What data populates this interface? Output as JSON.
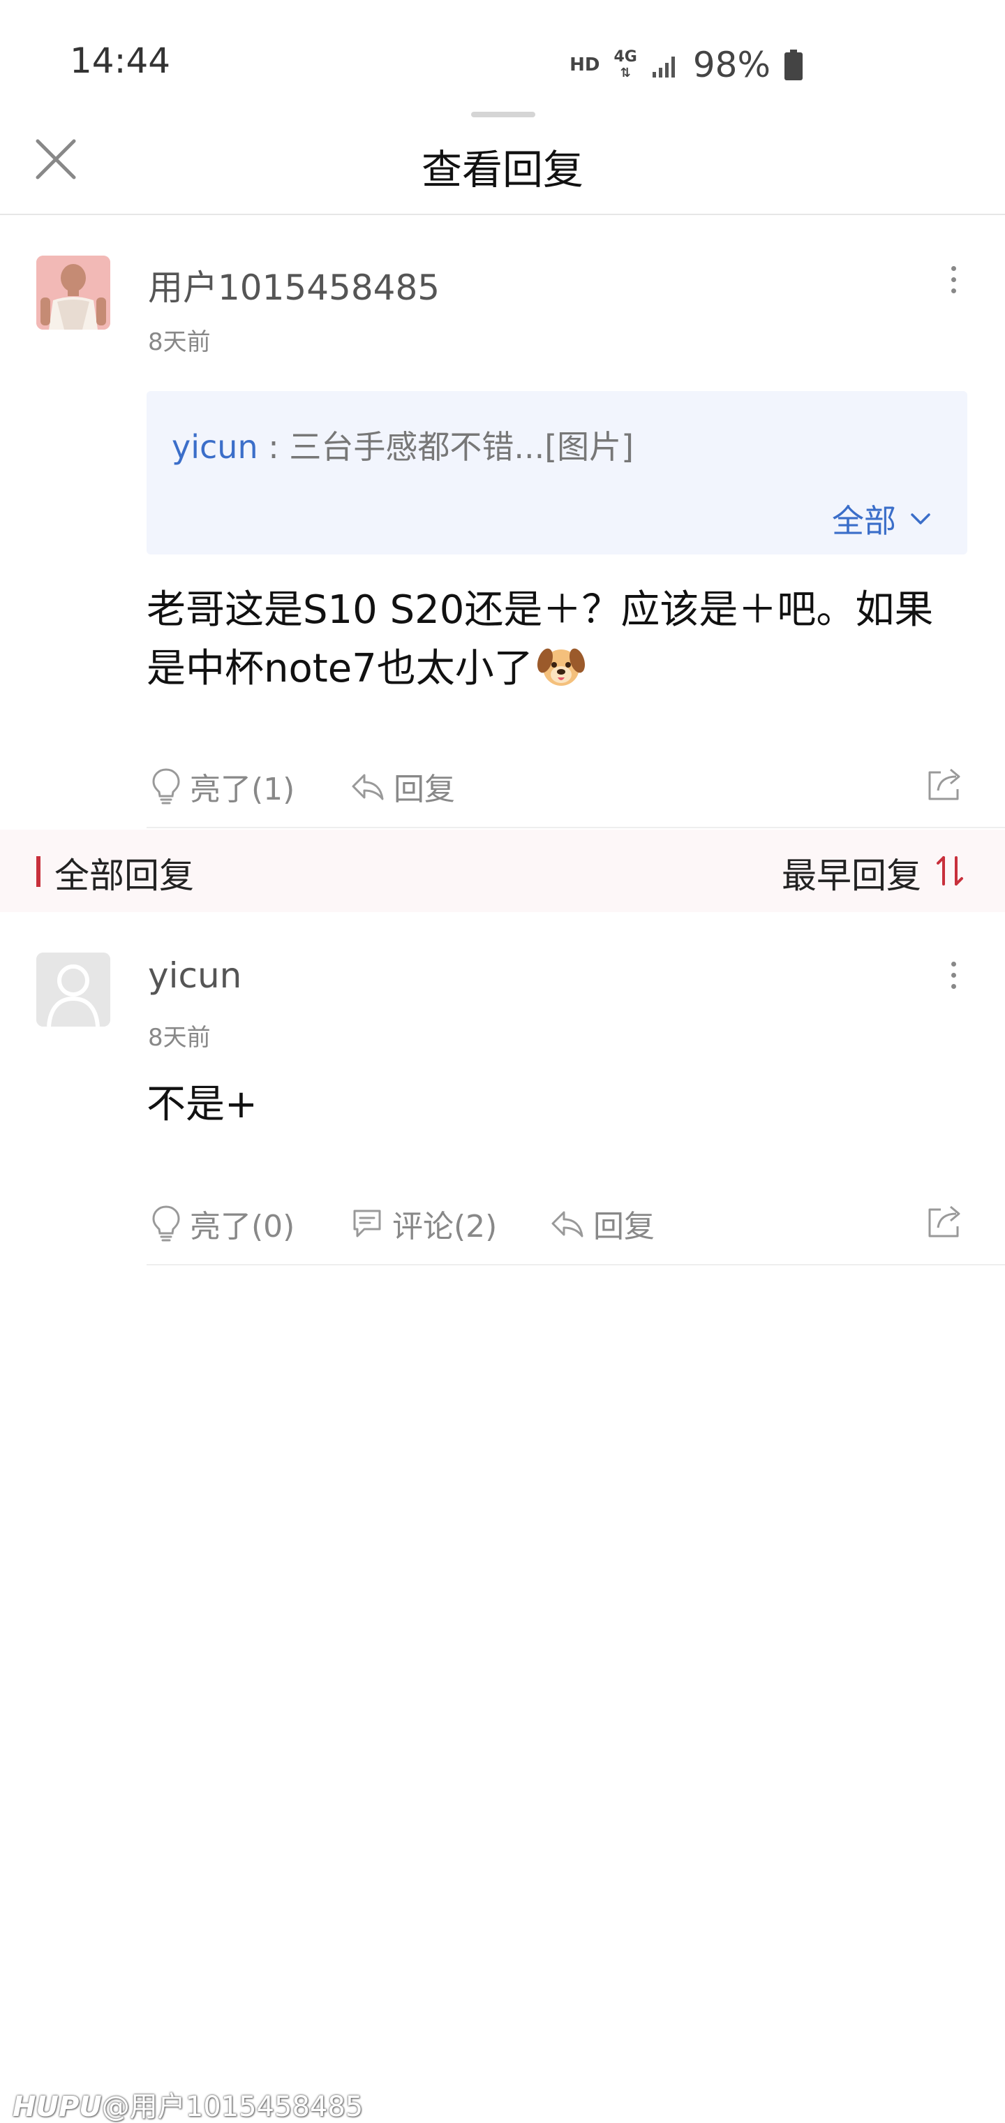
{
  "status_bar": {
    "time": "14:44",
    "hd": "HD",
    "network": "4G",
    "battery": "98%"
  },
  "header": {
    "title": "查看回复"
  },
  "main_comment": {
    "username": "用户1015458485",
    "time": "8天前",
    "quote": {
      "user": "yicun",
      "separator": " : ",
      "text": "三台手感都不错...[图片]",
      "expand_label": "全部"
    },
    "content_line1": "老哥这是S10 S20还是＋？应该是＋吧。如果",
    "content_line2": "是中杯note7也太小了",
    "actions": {
      "light": "亮了(1)",
      "reply": "回复"
    }
  },
  "replies_section": {
    "title": "全部回复",
    "sort_label": "最早回复"
  },
  "replies": [
    {
      "username": "yicun",
      "time": "8天前",
      "content": "不是+",
      "actions": {
        "light": "亮了(0)",
        "comment": "评论(2)",
        "reply": "回复"
      }
    }
  ],
  "watermark": {
    "brand": "HUPU",
    "handle": "@用户1015458485"
  },
  "colors": {
    "accent_blue": "#3b6ec9",
    "accent_red": "#c8303c",
    "quote_bg": "#f2f5fd",
    "section_bg": "#fdf7f8"
  }
}
